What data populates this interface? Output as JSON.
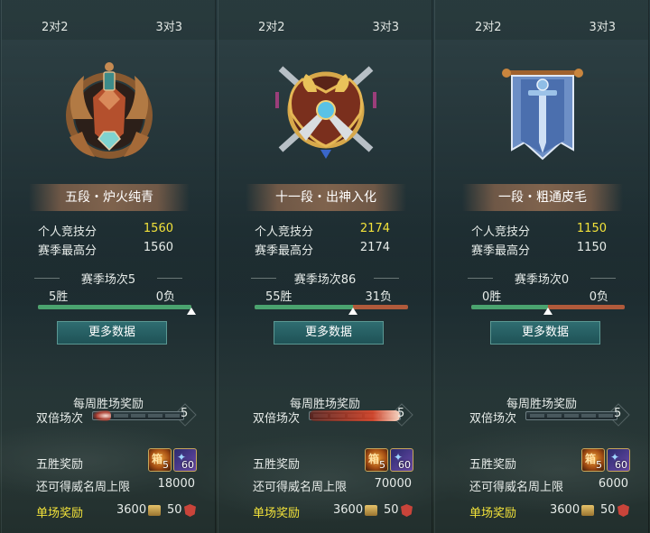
{
  "panels": [
    {
      "tabs": {
        "left": "2对2",
        "right": "3对3"
      },
      "rank": "五段・炉火纯青",
      "emblem": "bronze-winged-helmet-emblem",
      "personal_score_label": "个人竞技分",
      "personal_score": "1560",
      "season_high_label": "赛季最高分",
      "season_high": "1560",
      "season_games": "赛季场次5",
      "wins": "5胜",
      "losses": "0负",
      "win_ratio": 1.0,
      "more_button": "更多数据",
      "weekly_title": "每周胜场奖励",
      "double_label": "双倍场次",
      "double_count": "5",
      "double_progress": 0.2,
      "five_win_label": "五胜奖励",
      "item1_count": "5",
      "item2_count": "60",
      "cap_label": "还可得威名周上限",
      "cap_value": "18000",
      "single_label": "单场奖励",
      "coin_reward": "3600",
      "prestige_reward": "50"
    },
    {
      "tabs": {
        "left": "2对2",
        "right": "3对3"
      },
      "rank": "十一段・出神入化",
      "emblem": "golden-crossed-swords-emblem",
      "personal_score_label": "个人竞技分",
      "personal_score": "2174",
      "season_high_label": "赛季最高分",
      "season_high": "2174",
      "season_games": "赛季场次86",
      "wins": "55胜",
      "losses": "31负",
      "win_ratio": 0.64,
      "more_button": "更多数据",
      "weekly_title": "每周胜场奖励",
      "double_label": "双倍场次",
      "double_count": "5",
      "double_progress": 1.0,
      "five_win_label": "五胜奖励",
      "item1_count": "5",
      "item2_count": "60",
      "cap_label": "还可得威名周上限",
      "cap_value": "70000",
      "single_label": "单场奖励",
      "coin_reward": "3600",
      "prestige_reward": "50"
    },
    {
      "tabs": {
        "left": "2对2",
        "right": "3对3"
      },
      "rank": "一段・粗通皮毛",
      "emblem": "blue-sword-banner-emblem",
      "personal_score_label": "个人竞技分",
      "personal_score": "1150",
      "season_high_label": "赛季最高分",
      "season_high": "1150",
      "season_games": "赛季场次0",
      "wins": "0胜",
      "losses": "0负",
      "win_ratio": 0.5,
      "more_button": "更多数据",
      "weekly_title": "每周胜场奖励",
      "double_label": "双倍场次",
      "double_count": "5",
      "double_progress": 0.0,
      "five_win_label": "五胜奖励",
      "item1_count": "5",
      "item2_count": "60",
      "cap_label": "还可得威名周上限",
      "cap_value": "6000",
      "single_label": "单场奖励",
      "coin_reward": "3600",
      "prestige_reward": "50"
    }
  ],
  "colors": {
    "highlight": "#f2e23a",
    "win_bar": "#4aa36f",
    "loss_bar": "#b05a3b",
    "button": "#2f6d71"
  }
}
